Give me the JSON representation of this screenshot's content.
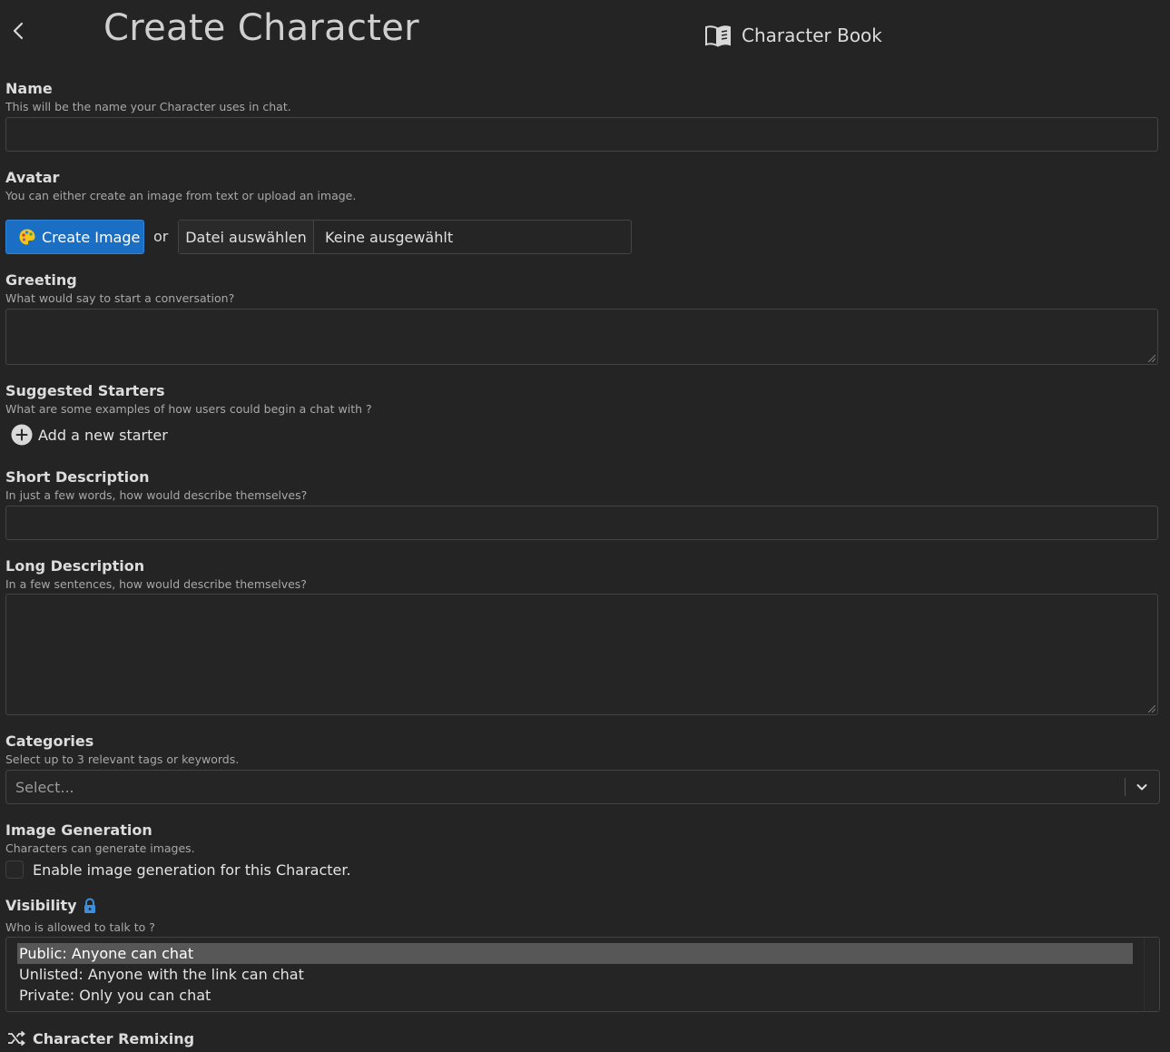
{
  "header": {
    "title": "Create Character",
    "character_book_label": "Character Book"
  },
  "name": {
    "label": "Name",
    "help": "This will be the name your Character uses in chat.",
    "value": ""
  },
  "avatar": {
    "label": "Avatar",
    "help": "You can either create an image from text or upload an image.",
    "create_image_label": "Create Image",
    "or_text": "or",
    "file_button_label": "Datei auswählen",
    "file_status": "Keine ausgewählt"
  },
  "greeting": {
    "label": "Greeting",
    "help": "What would say to start a conversation?",
    "value": ""
  },
  "suggested_starters": {
    "label": "Suggested Starters",
    "help": "What are some examples of how users could begin a chat with ?",
    "add_label": "Add a new starter"
  },
  "short_description": {
    "label": "Short Description",
    "help": "In just a few words, how would describe themselves?",
    "value": ""
  },
  "long_description": {
    "label": "Long Description",
    "help": "In a few sentences, how would describe themselves?",
    "value": ""
  },
  "categories": {
    "label": "Categories",
    "help": "Select up to 3 relevant tags or keywords.",
    "placeholder": "Select..."
  },
  "image_generation": {
    "label": "Image Generation",
    "help": "Characters can generate images.",
    "checkbox_label": "Enable image generation for this Character.",
    "checked": false
  },
  "visibility": {
    "label": "Visibility",
    "help": "Who is allowed to talk to ?",
    "options": [
      "Public: Anyone can chat",
      "Unlisted: Anyone with the link can chat",
      "Private: Only you can chat"
    ],
    "selected_index": 0
  },
  "remixing": {
    "label": "Character Remixing"
  },
  "colors": {
    "background": "#242424",
    "accent": "#1a6fc4",
    "lock": "#3b8fe0"
  },
  "icons": {
    "back": "chevron-left-icon",
    "book": "book-icon",
    "palette": "palette-icon",
    "plus": "plus-circle-icon",
    "dropdown": "chevron-down-icon",
    "lock": "lock-icon",
    "remix": "shuffle-icon"
  }
}
